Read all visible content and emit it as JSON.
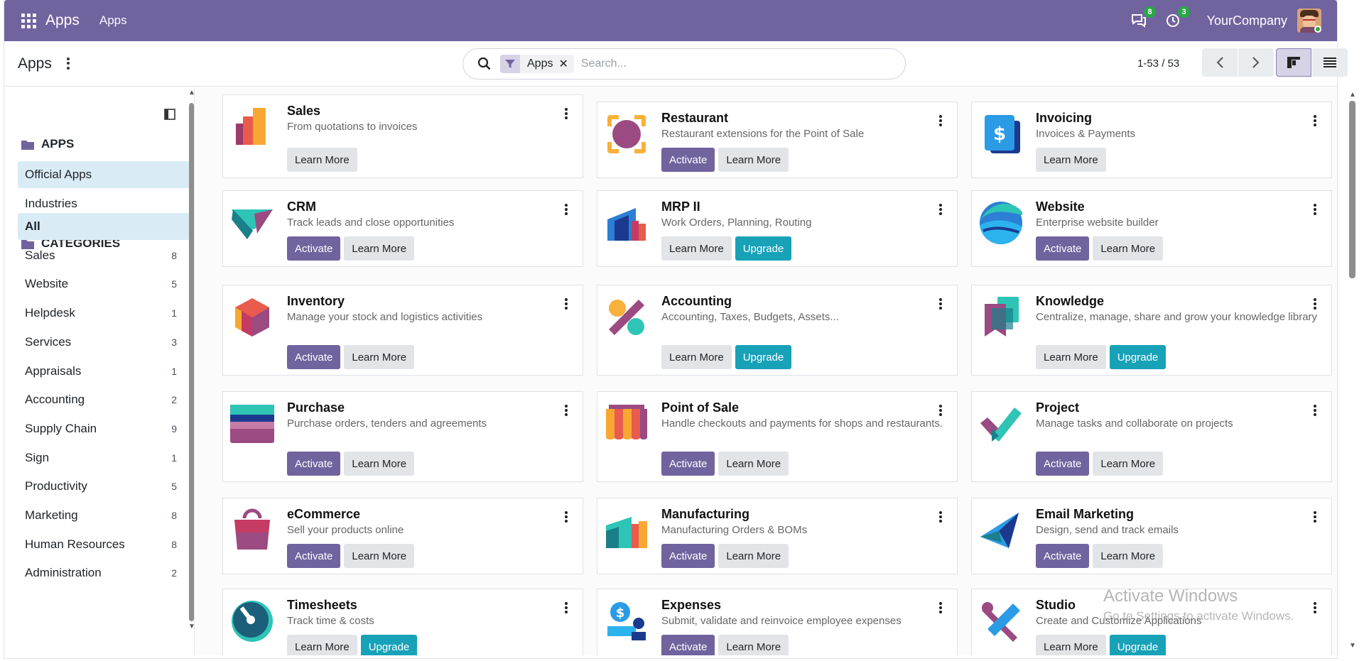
{
  "navbar": {
    "brand": "Apps",
    "menu_item": "Apps",
    "messages_count": "8",
    "activities_count": "3",
    "company": "YourCompany"
  },
  "control": {
    "title": "Apps",
    "facet_label": "Apps",
    "search_placeholder": "Search...",
    "pager": "1-53 / 53"
  },
  "sidebar": {
    "section_apps": "APPS",
    "apps_items": [
      {
        "label": "Official Apps"
      },
      {
        "label": "Industries"
      }
    ],
    "section_categories": "CATEGORIES",
    "categories": [
      {
        "label": "All",
        "count": ""
      },
      {
        "label": "Sales",
        "count": "8"
      },
      {
        "label": "Website",
        "count": "5"
      },
      {
        "label": "Helpdesk",
        "count": "1"
      },
      {
        "label": "Services",
        "count": "3"
      },
      {
        "label": "Appraisals",
        "count": "1"
      },
      {
        "label": "Accounting",
        "count": "2"
      },
      {
        "label": "Supply Chain",
        "count": "9"
      },
      {
        "label": "Sign",
        "count": "1"
      },
      {
        "label": "Productivity",
        "count": "5"
      },
      {
        "label": "Marketing",
        "count": "8"
      },
      {
        "label": "Human Resources",
        "count": "8"
      },
      {
        "label": "Administration",
        "count": "2"
      }
    ]
  },
  "buttons": {
    "activate": "Activate",
    "learn_more": "Learn More",
    "upgrade": "Upgrade"
  },
  "apps": [
    {
      "name": "Sales",
      "summary": "From quotations to invoices",
      "icon": "sales-icon"
    },
    {
      "name": "Restaurant",
      "summary": "Restaurant extensions for the Point of Sale",
      "icon": "restaurant-icon"
    },
    {
      "name": "Invoicing",
      "summary": "Invoices & Payments",
      "icon": "invoicing-icon"
    },
    {
      "name": "CRM",
      "summary": "Track leads and close opportunities",
      "icon": "crm-icon"
    },
    {
      "name": "MRP II",
      "summary": "Work Orders, Planning, Routing",
      "icon": "mrp-icon"
    },
    {
      "name": "Website",
      "summary": "Enterprise website builder",
      "icon": "website-icon"
    },
    {
      "name": "Inventory",
      "summary": "Manage your stock and logistics activities",
      "icon": "inventory-icon"
    },
    {
      "name": "Accounting",
      "summary": "Accounting, Taxes, Budgets, Assets...",
      "icon": "accounting-icon"
    },
    {
      "name": "Knowledge",
      "summary": "Centralize, manage, share and grow your knowledge library",
      "icon": "knowledge-icon"
    },
    {
      "name": "Purchase",
      "summary": "Purchase orders, tenders and agreements",
      "icon": "purchase-icon"
    },
    {
      "name": "Point of Sale",
      "summary": "Handle checkouts and payments for shops and restaurants.",
      "icon": "point-of-sale-icon"
    },
    {
      "name": "Project",
      "summary": "Manage tasks and collaborate on projects",
      "icon": "project-icon"
    },
    {
      "name": "eCommerce",
      "summary": "Sell your products online",
      "icon": "ecommerce-icon"
    },
    {
      "name": "Manufacturing",
      "summary": "Manufacturing Orders & BOMs",
      "icon": "manufacturing-icon"
    },
    {
      "name": "Email Marketing",
      "summary": "Design, send and track emails",
      "icon": "email-marketing-icon"
    },
    {
      "name": "Timesheets",
      "summary": "Track time & costs",
      "icon": "timesheets-icon"
    },
    {
      "name": "Expenses",
      "summary": "Submit, validate and reinvoice employee expenses",
      "icon": "expenses-icon"
    },
    {
      "name": "Studio",
      "summary": "Create and Customize Applications",
      "icon": "studio-icon"
    }
  ],
  "watermark": {
    "line1": "Activate Windows",
    "line2": "Go to Settings to activate Windows."
  },
  "colors": {
    "brand": "#71639e",
    "upgrade": "#17a2b8",
    "badge": "#28a745"
  }
}
